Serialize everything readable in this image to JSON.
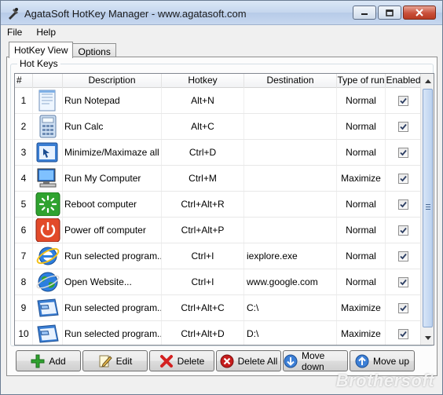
{
  "window": {
    "title": "AgataSoft HotKey Manager  -  www.agatasoft.com"
  },
  "menu": {
    "items": [
      "File",
      "Help"
    ]
  },
  "tabs": [
    {
      "label": "HotKey View",
      "active": true
    },
    {
      "label": "Options",
      "active": false
    }
  ],
  "group": {
    "label": "Hot Keys"
  },
  "table": {
    "columns": [
      "#",
      "Description",
      "Hotkey",
      "Destination",
      "Type of run",
      "Enabled"
    ],
    "rows": [
      {
        "num": "1",
        "icon": "notepad-icon",
        "description": "Run Notepad",
        "hotkey": "Alt+N",
        "destination": "",
        "type": "Normal",
        "enabled": true
      },
      {
        "num": "2",
        "icon": "calculator-icon",
        "description": "Run Calc",
        "hotkey": "Alt+C",
        "destination": "",
        "type": "Normal",
        "enabled": true
      },
      {
        "num": "3",
        "icon": "minimize-windows-icon",
        "description": "Minimize/Maximaze all ...",
        "hotkey": "Ctrl+D",
        "destination": "",
        "type": "Normal",
        "enabled": true
      },
      {
        "num": "4",
        "icon": "my-computer-icon",
        "description": "Run My Computer",
        "hotkey": "Ctrl+M",
        "destination": "",
        "type": "Maximize",
        "enabled": true
      },
      {
        "num": "5",
        "icon": "reboot-icon",
        "description": "Reboot computer",
        "hotkey": "Ctrl+Alt+R",
        "destination": "",
        "type": "Normal",
        "enabled": true
      },
      {
        "num": "6",
        "icon": "power-off-icon",
        "description": "Power off computer",
        "hotkey": "Ctrl+Alt+P",
        "destination": "",
        "type": "Normal",
        "enabled": true
      },
      {
        "num": "7",
        "icon": "internet-explorer-icon",
        "description": "Run selected program...",
        "hotkey": "Ctrl+I",
        "destination": "iexplore.exe",
        "type": "Normal",
        "enabled": true
      },
      {
        "num": "8",
        "icon": "website-globe-icon",
        "description": "Open Website...",
        "hotkey": "Ctrl+I",
        "destination": "www.google.com",
        "type": "Normal",
        "enabled": true
      },
      {
        "num": "9",
        "icon": "run-program-window-icon",
        "description": "Run selected program...",
        "hotkey": "Ctrl+Alt+C",
        "destination": "C:\\",
        "type": "Maximize",
        "enabled": true
      },
      {
        "num": "10",
        "icon": "run-program-window-icon",
        "description": "Run selected program...",
        "hotkey": "Ctrl+Alt+D",
        "destination": "D:\\",
        "type": "Maximize",
        "enabled": true
      }
    ]
  },
  "buttons": {
    "add": "Add",
    "edit": "Edit",
    "delete": "Delete",
    "delete_all": "Delete All",
    "move_down": "Move down",
    "move_up": "Move up"
  },
  "watermark": "Brothersoft",
  "colors": {
    "selection_blue": "#3c7fd6",
    "add_green": "#2fa22f",
    "delete_red": "#d32020"
  }
}
